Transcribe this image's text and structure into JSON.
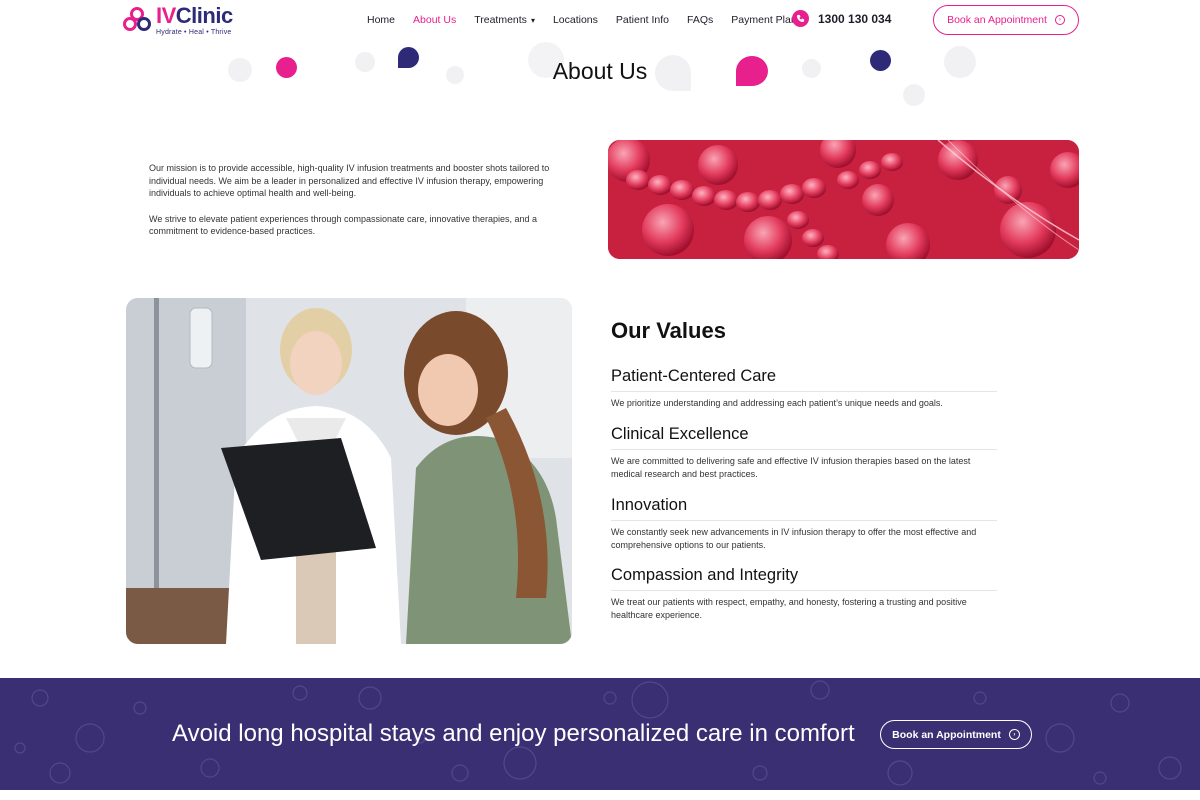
{
  "header": {
    "logo": {
      "iv": "IV",
      "clinic": "Clinic",
      "tagline": "Hydrate • Heal • Thrive"
    },
    "nav": [
      {
        "label": "Home"
      },
      {
        "label": "About Us",
        "active": true
      },
      {
        "label": "Treatments",
        "dropdown": true
      },
      {
        "label": "Locations"
      },
      {
        "label": "Patient Info"
      },
      {
        "label": "FAQs"
      },
      {
        "label": "Payment Plans"
      }
    ],
    "phone": "1300 130 034",
    "book_label": "Book an Appointment"
  },
  "page": {
    "title": "About Us"
  },
  "mission": {
    "p1": "Our mission is to provide accessible, high-quality IV infusion treatments and booster shots tailored to individual needs. We aim be a leader in personalized and effective IV infusion therapy, empowering individuals to achieve optimal health and well-being.",
    "p2": "We strive to elevate patient experiences through compassionate care, innovative therapies, and a commitment to evidence-based practices."
  },
  "values": {
    "title": "Our Values",
    "items": [
      {
        "heading": "Patient-Centered Care",
        "text": "We prioritize understanding and addressing each patient’s unique needs and goals."
      },
      {
        "heading": "Clinical Excellence",
        "text": "We are committed to delivering safe and effective IV infusion therapies based on the latest medical research and best practices."
      },
      {
        "heading": "Innovation",
        "text": "We constantly seek new advancements in IV infusion therapy to offer the most effective and comprehensive options to our patients."
      },
      {
        "heading": "Compassion and Integrity",
        "text": "We treat our patients with respect, empathy, and honesty, fostering a trusting and positive healthcare experience."
      }
    ]
  },
  "banner": {
    "text": "Avoid long hospital stays and enjoy personalized care in comfort",
    "book_label": "Book an Appointment"
  },
  "colors": {
    "accent": "#e8208d",
    "brand_navy": "#2d2a78",
    "banner_bg": "#3b2f73"
  },
  "icons": [
    "logo-icon",
    "phone-icon",
    "chevron-down-icon",
    "arrow-circle-icon"
  ]
}
